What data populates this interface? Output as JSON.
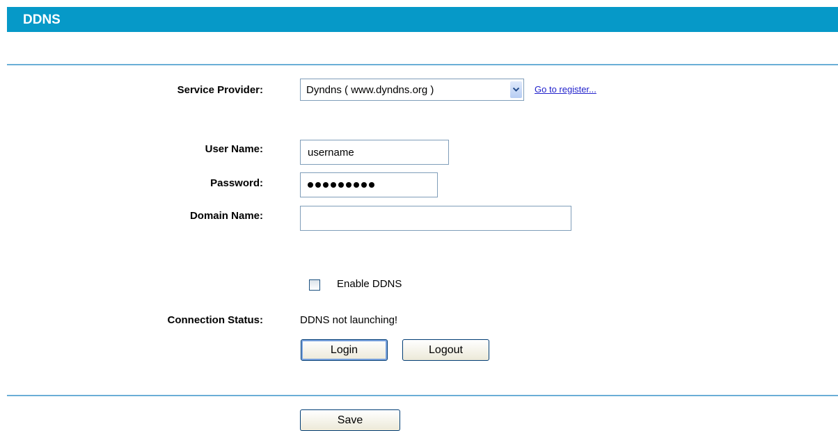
{
  "header": {
    "title": "DDNS"
  },
  "form": {
    "service_provider": {
      "label": "Service Provider:",
      "selected": "Dyndns ( www.dyndns.org )",
      "register_link": "Go to register..."
    },
    "username": {
      "label": "User Name:",
      "value": "username"
    },
    "password": {
      "label": "Password:",
      "masked_length": 9
    },
    "domain": {
      "label": "Domain Name:",
      "value": ""
    },
    "enable": {
      "label": "Enable DDNS",
      "checked": false
    },
    "status": {
      "label": "Connection Status:",
      "value": "DDNS not launching!"
    },
    "buttons": {
      "login": "Login",
      "logout": "Logout",
      "save": "Save"
    }
  }
}
